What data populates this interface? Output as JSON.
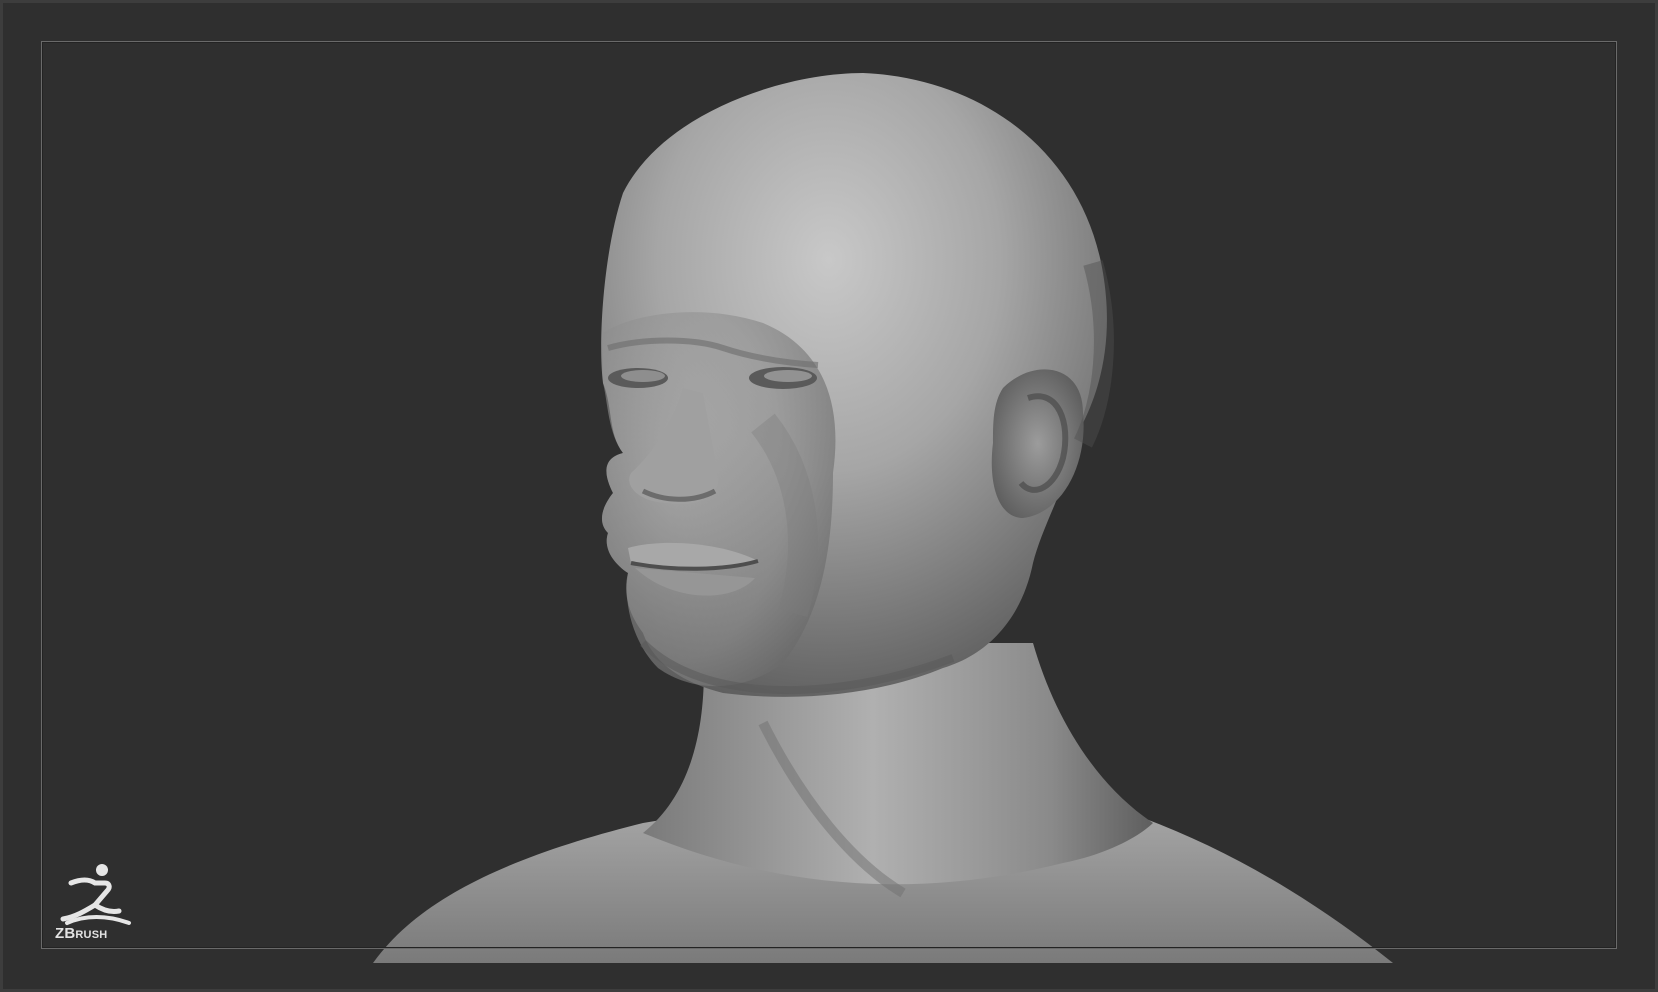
{
  "app": {
    "logo_text_major": "ZB",
    "logo_text_minor": "RUSH"
  },
  "viewport": {
    "background": "#2f2f2f",
    "frame_color": "#6a6a6a",
    "model_color": "#9a9a9a"
  },
  "icons": {
    "logo": "zbrush-runner-icon"
  }
}
